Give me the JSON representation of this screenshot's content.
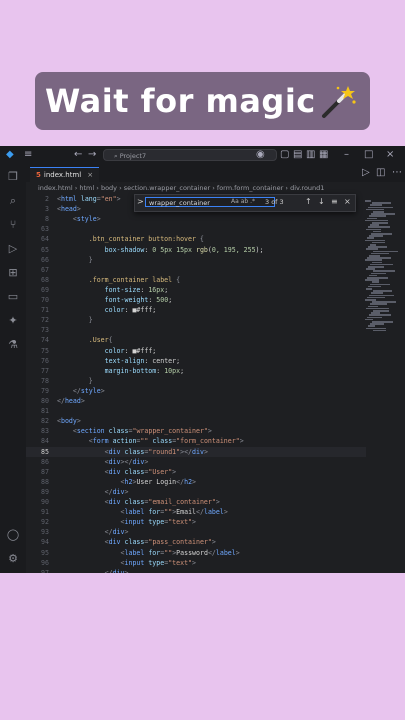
{
  "banner": {
    "text": "Wait for magic",
    "icon": "magic-wand-icon"
  },
  "window": {
    "search_text": "Project7"
  },
  "tab": {
    "label": "index.html"
  },
  "breadcrumb": [
    "index.html",
    "html",
    "body",
    "section.wrapper_container",
    "form.form_container",
    "div.round1"
  ],
  "find": {
    "query": "wrapper_container",
    "options": "Aa ab .*",
    "count": "3 of 3",
    "prev": "↑",
    "next": "↓",
    "menu": "≡",
    "close": "×",
    "expand": ">"
  },
  "code": [
    {
      "n": "2",
      "t": [
        [
          "t-br",
          "<"
        ],
        [
          "t-tag",
          "html"
        ],
        [
          "t-attr",
          " lang"
        ],
        [
          "t-br",
          "="
        ],
        [
          "t-str",
          "\"en\""
        ],
        [
          "t-br",
          ">"
        ]
      ]
    },
    {
      "n": "3",
      "t": [
        [
          "t-br",
          "<"
        ],
        [
          "t-tag",
          "head"
        ],
        [
          "t-br",
          ">"
        ]
      ]
    },
    {
      "n": "8",
      "t": [
        [
          "t-br",
          "    <"
        ],
        [
          "t-tag",
          "style"
        ],
        [
          "t-br",
          ">"
        ]
      ]
    },
    {
      "n": "63",
      "t": []
    },
    {
      "n": "64",
      "t": [
        [
          "t-sel",
          "        .btn_container button:hover "
        ],
        [
          "t-br",
          "{"
        ]
      ]
    },
    {
      "n": "65",
      "t": [
        [
          "t-prop",
          "            box-shadow"
        ],
        [
          "t-txt",
          ": "
        ],
        [
          "t-num",
          "0 5px 15px "
        ],
        [
          "t-fn",
          "rgb"
        ],
        [
          "t-txt",
          "("
        ],
        [
          "t-num",
          "0, 195, 255"
        ],
        [
          "t-txt",
          ");"
        ]
      ]
    },
    {
      "n": "66",
      "t": [
        [
          "t-br",
          "        }"
        ]
      ]
    },
    {
      "n": "67",
      "t": []
    },
    {
      "n": "68",
      "t": [
        [
          "t-sel",
          "        .form_container label "
        ],
        [
          "t-br",
          "{"
        ]
      ]
    },
    {
      "n": "69",
      "t": [
        [
          "t-prop",
          "            font-size"
        ],
        [
          "t-txt",
          ": "
        ],
        [
          "t-num",
          "16px"
        ],
        [
          "t-txt",
          ";"
        ]
      ]
    },
    {
      "n": "70",
      "t": [
        [
          "t-prop",
          "            font-weight"
        ],
        [
          "t-txt",
          ": "
        ],
        [
          "t-num",
          "500"
        ],
        [
          "t-txt",
          ";"
        ]
      ]
    },
    {
      "n": "71",
      "t": [
        [
          "t-prop",
          "            color"
        ],
        [
          "t-txt",
          ": "
        ],
        [
          "t-txt",
          "■#fff;"
        ]
      ]
    },
    {
      "n": "72",
      "t": [
        [
          "t-br",
          "        }"
        ]
      ]
    },
    {
      "n": "73",
      "t": []
    },
    {
      "n": "74",
      "t": [
        [
          "t-sel",
          "        .User"
        ],
        [
          "t-br",
          "{"
        ]
      ]
    },
    {
      "n": "75",
      "t": [
        [
          "t-prop",
          "            color"
        ],
        [
          "t-txt",
          ": "
        ],
        [
          "t-txt",
          "■#fff;"
        ]
      ]
    },
    {
      "n": "76",
      "t": [
        [
          "t-prop",
          "            text-align"
        ],
        [
          "t-txt",
          ": center;"
        ]
      ]
    },
    {
      "n": "77",
      "t": [
        [
          "t-prop",
          "            margin-bottom"
        ],
        [
          "t-txt",
          ": "
        ],
        [
          "t-num",
          "10px"
        ],
        [
          "t-txt",
          ";"
        ]
      ]
    },
    {
      "n": "78",
      "t": [
        [
          "t-br",
          "        }"
        ]
      ]
    },
    {
      "n": "79",
      "t": [
        [
          "t-br",
          "    </"
        ],
        [
          "t-tag",
          "style"
        ],
        [
          "t-br",
          ">"
        ]
      ]
    },
    {
      "n": "80",
      "t": [
        [
          "t-br",
          "</"
        ],
        [
          "t-tag",
          "head"
        ],
        [
          "t-br",
          ">"
        ]
      ]
    },
    {
      "n": "81",
      "t": []
    },
    {
      "n": "82",
      "t": [
        [
          "t-br",
          "<"
        ],
        [
          "t-tag",
          "body"
        ],
        [
          "t-br",
          ">"
        ]
      ]
    },
    {
      "n": "83",
      "t": [
        [
          "t-br",
          "    <"
        ],
        [
          "t-tag",
          "section"
        ],
        [
          "t-attr",
          " class"
        ],
        [
          "t-br",
          "="
        ],
        [
          "t-str",
          "\"wrapper_container\""
        ],
        [
          "t-br",
          ">"
        ]
      ]
    },
    {
      "n": "84",
      "t": [
        [
          "t-br",
          "        <"
        ],
        [
          "t-tag",
          "form"
        ],
        [
          "t-attr",
          " action"
        ],
        [
          "t-br",
          "="
        ],
        [
          "t-str",
          "\"\""
        ],
        [
          "t-attr",
          " class"
        ],
        [
          "t-br",
          "="
        ],
        [
          "t-str",
          "\"form_container\""
        ],
        [
          "t-br",
          ">"
        ]
      ]
    },
    {
      "n": "85",
      "t": [
        [
          "t-br",
          "            <"
        ],
        [
          "t-tag",
          "div"
        ],
        [
          "t-attr",
          " class"
        ],
        [
          "t-br",
          "="
        ],
        [
          "t-str",
          "\"round1\""
        ],
        [
          "t-br",
          "></"
        ],
        [
          "t-tag",
          "div"
        ],
        [
          "t-br",
          ">"
        ]
      ],
      "cur": true
    },
    {
      "n": "86",
      "t": [
        [
          "t-br",
          "            <"
        ],
        [
          "t-tag",
          "div"
        ],
        [
          "t-br",
          "></"
        ],
        [
          "t-tag",
          "div"
        ],
        [
          "t-br",
          ">"
        ]
      ]
    },
    {
      "n": "87",
      "t": [
        [
          "t-br",
          "            <"
        ],
        [
          "t-tag",
          "div"
        ],
        [
          "t-attr",
          " class"
        ],
        [
          "t-br",
          "="
        ],
        [
          "t-str",
          "\"User\""
        ],
        [
          "t-br",
          ">"
        ]
      ]
    },
    {
      "n": "88",
      "t": [
        [
          "t-br",
          "                <"
        ],
        [
          "t-tag",
          "h2"
        ],
        [
          "t-br",
          ">"
        ],
        [
          "t-txt",
          "User Login"
        ],
        [
          "t-br",
          "</"
        ],
        [
          "t-tag",
          "h2"
        ],
        [
          "t-br",
          ">"
        ]
      ]
    },
    {
      "n": "89",
      "t": [
        [
          "t-br",
          "            </"
        ],
        [
          "t-tag",
          "div"
        ],
        [
          "t-br",
          ">"
        ]
      ]
    },
    {
      "n": "90",
      "t": [
        [
          "t-br",
          "            <"
        ],
        [
          "t-tag",
          "div"
        ],
        [
          "t-attr",
          " class"
        ],
        [
          "t-br",
          "="
        ],
        [
          "t-str",
          "\"email_container\""
        ],
        [
          "t-br",
          ">"
        ]
      ]
    },
    {
      "n": "91",
      "t": [
        [
          "t-br",
          "                <"
        ],
        [
          "t-tag",
          "label"
        ],
        [
          "t-attr",
          " for"
        ],
        [
          "t-br",
          "="
        ],
        [
          "t-str",
          "\"\""
        ],
        [
          "t-br",
          ">"
        ],
        [
          "t-txt",
          "Email"
        ],
        [
          "t-br",
          "</"
        ],
        [
          "t-tag",
          "label"
        ],
        [
          "t-br",
          ">"
        ]
      ]
    },
    {
      "n": "92",
      "t": [
        [
          "t-br",
          "                <"
        ],
        [
          "t-tag",
          "input"
        ],
        [
          "t-attr",
          " type"
        ],
        [
          "t-br",
          "="
        ],
        [
          "t-str",
          "\"text\""
        ],
        [
          "t-br",
          ">"
        ]
      ]
    },
    {
      "n": "93",
      "t": [
        [
          "t-br",
          "            </"
        ],
        [
          "t-tag",
          "div"
        ],
        [
          "t-br",
          ">"
        ]
      ]
    },
    {
      "n": "94",
      "t": [
        [
          "t-br",
          "            <"
        ],
        [
          "t-tag",
          "div"
        ],
        [
          "t-attr",
          " class"
        ],
        [
          "t-br",
          "="
        ],
        [
          "t-str",
          "\"pass_container\""
        ],
        [
          "t-br",
          ">"
        ]
      ]
    },
    {
      "n": "95",
      "t": [
        [
          "t-br",
          "                <"
        ],
        [
          "t-tag",
          "label"
        ],
        [
          "t-attr",
          " for"
        ],
        [
          "t-br",
          "="
        ],
        [
          "t-str",
          "\"\""
        ],
        [
          "t-br",
          ">"
        ],
        [
          "t-txt",
          "Password"
        ],
        [
          "t-br",
          "</"
        ],
        [
          "t-tag",
          "label"
        ],
        [
          "t-br",
          ">"
        ]
      ]
    },
    {
      "n": "96",
      "t": [
        [
          "t-br",
          "                <"
        ],
        [
          "t-tag",
          "input"
        ],
        [
          "t-attr",
          " type"
        ],
        [
          "t-br",
          "="
        ],
        [
          "t-str",
          "\"text\""
        ],
        [
          "t-br",
          ">"
        ]
      ]
    },
    {
      "n": "97",
      "t": [
        [
          "t-br",
          "            </"
        ],
        [
          "t-tag",
          "div"
        ],
        [
          "t-br",
          ">"
        ]
      ]
    }
  ]
}
